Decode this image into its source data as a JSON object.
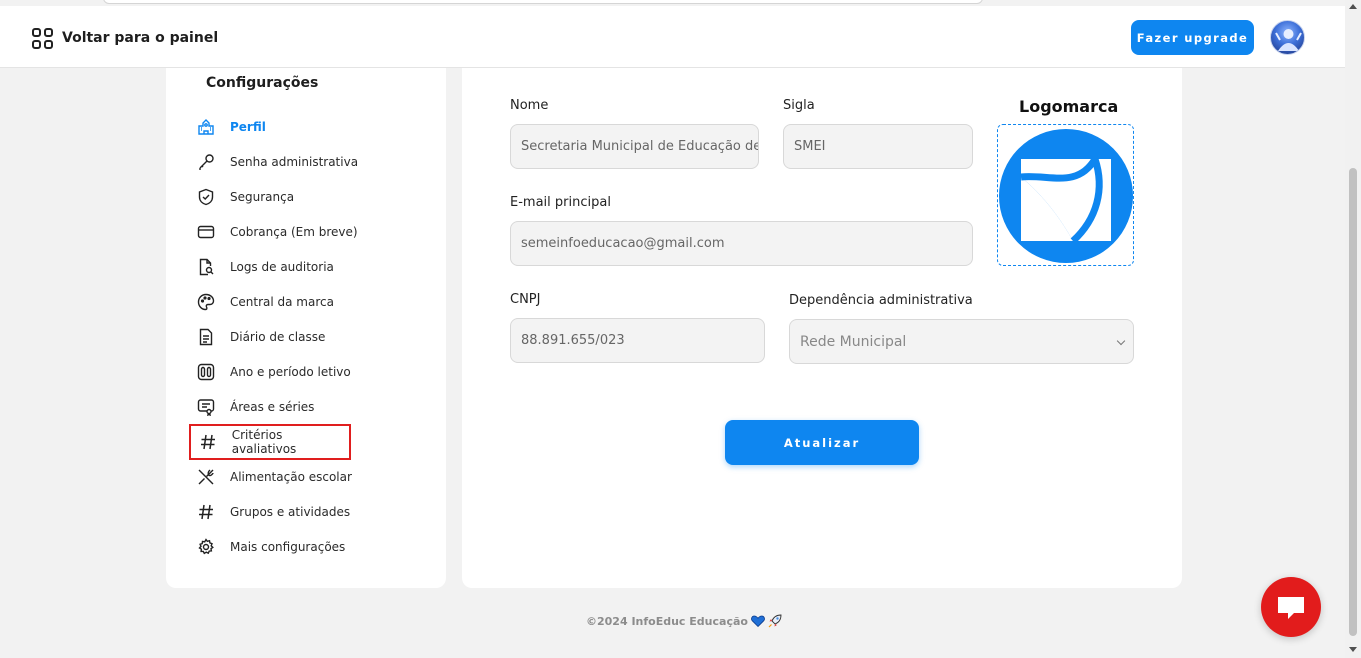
{
  "header": {
    "back_label": "Voltar para o painel",
    "upgrade_label": "Fazer upgrade"
  },
  "sidebar": {
    "title": "Configurações",
    "items": [
      {
        "label": "Perfil",
        "icon": "school-building-icon",
        "active": true
      },
      {
        "label": "Senha administrativa",
        "icon": "key-icon"
      },
      {
        "label": "Segurança",
        "icon": "shield-check-icon"
      },
      {
        "label": "Cobrança (Em breve)",
        "icon": "wallet-icon"
      },
      {
        "label": "Logs de auditoria",
        "icon": "document-search-icon"
      },
      {
        "label": "Central da marca",
        "icon": "palette-icon"
      },
      {
        "label": "Diário de classe",
        "icon": "file-text-icon"
      },
      {
        "label": "Ano e período letivo",
        "icon": "calendar-columns-icon"
      },
      {
        "label": "Áreas e séries",
        "icon": "monitor-icon"
      },
      {
        "label": "Critérios avaliativos",
        "icon": "hash-icon",
        "highlighted": true
      },
      {
        "label": "Alimentação escolar",
        "icon": "utensils-icon"
      },
      {
        "label": "Grupos e atividades",
        "icon": "hash-icon"
      },
      {
        "label": "Mais configurações",
        "icon": "gear-icon"
      }
    ]
  },
  "form": {
    "nome_label": "Nome",
    "nome_value": "Secretaria Municipal de Educação de",
    "sigla_label": "Sigla",
    "sigla_value": "SMEI",
    "email_label": "E-mail principal",
    "email_value": "semeinfoeducacao@gmail.com",
    "cnpj_label": "CNPJ",
    "cnpj_value": "88.891.655/023",
    "dependencia_label": "Dependência administrativa",
    "dependencia_value": "Rede Municipal",
    "logo_label": "Logomarca",
    "submit_label": "Atualizar"
  },
  "footer": {
    "text": "©2024 InfoEduc Educação"
  },
  "colors": {
    "accent": "#0e86f0",
    "highlight_border": "#e01e1e",
    "chat": "#e21c1c"
  }
}
